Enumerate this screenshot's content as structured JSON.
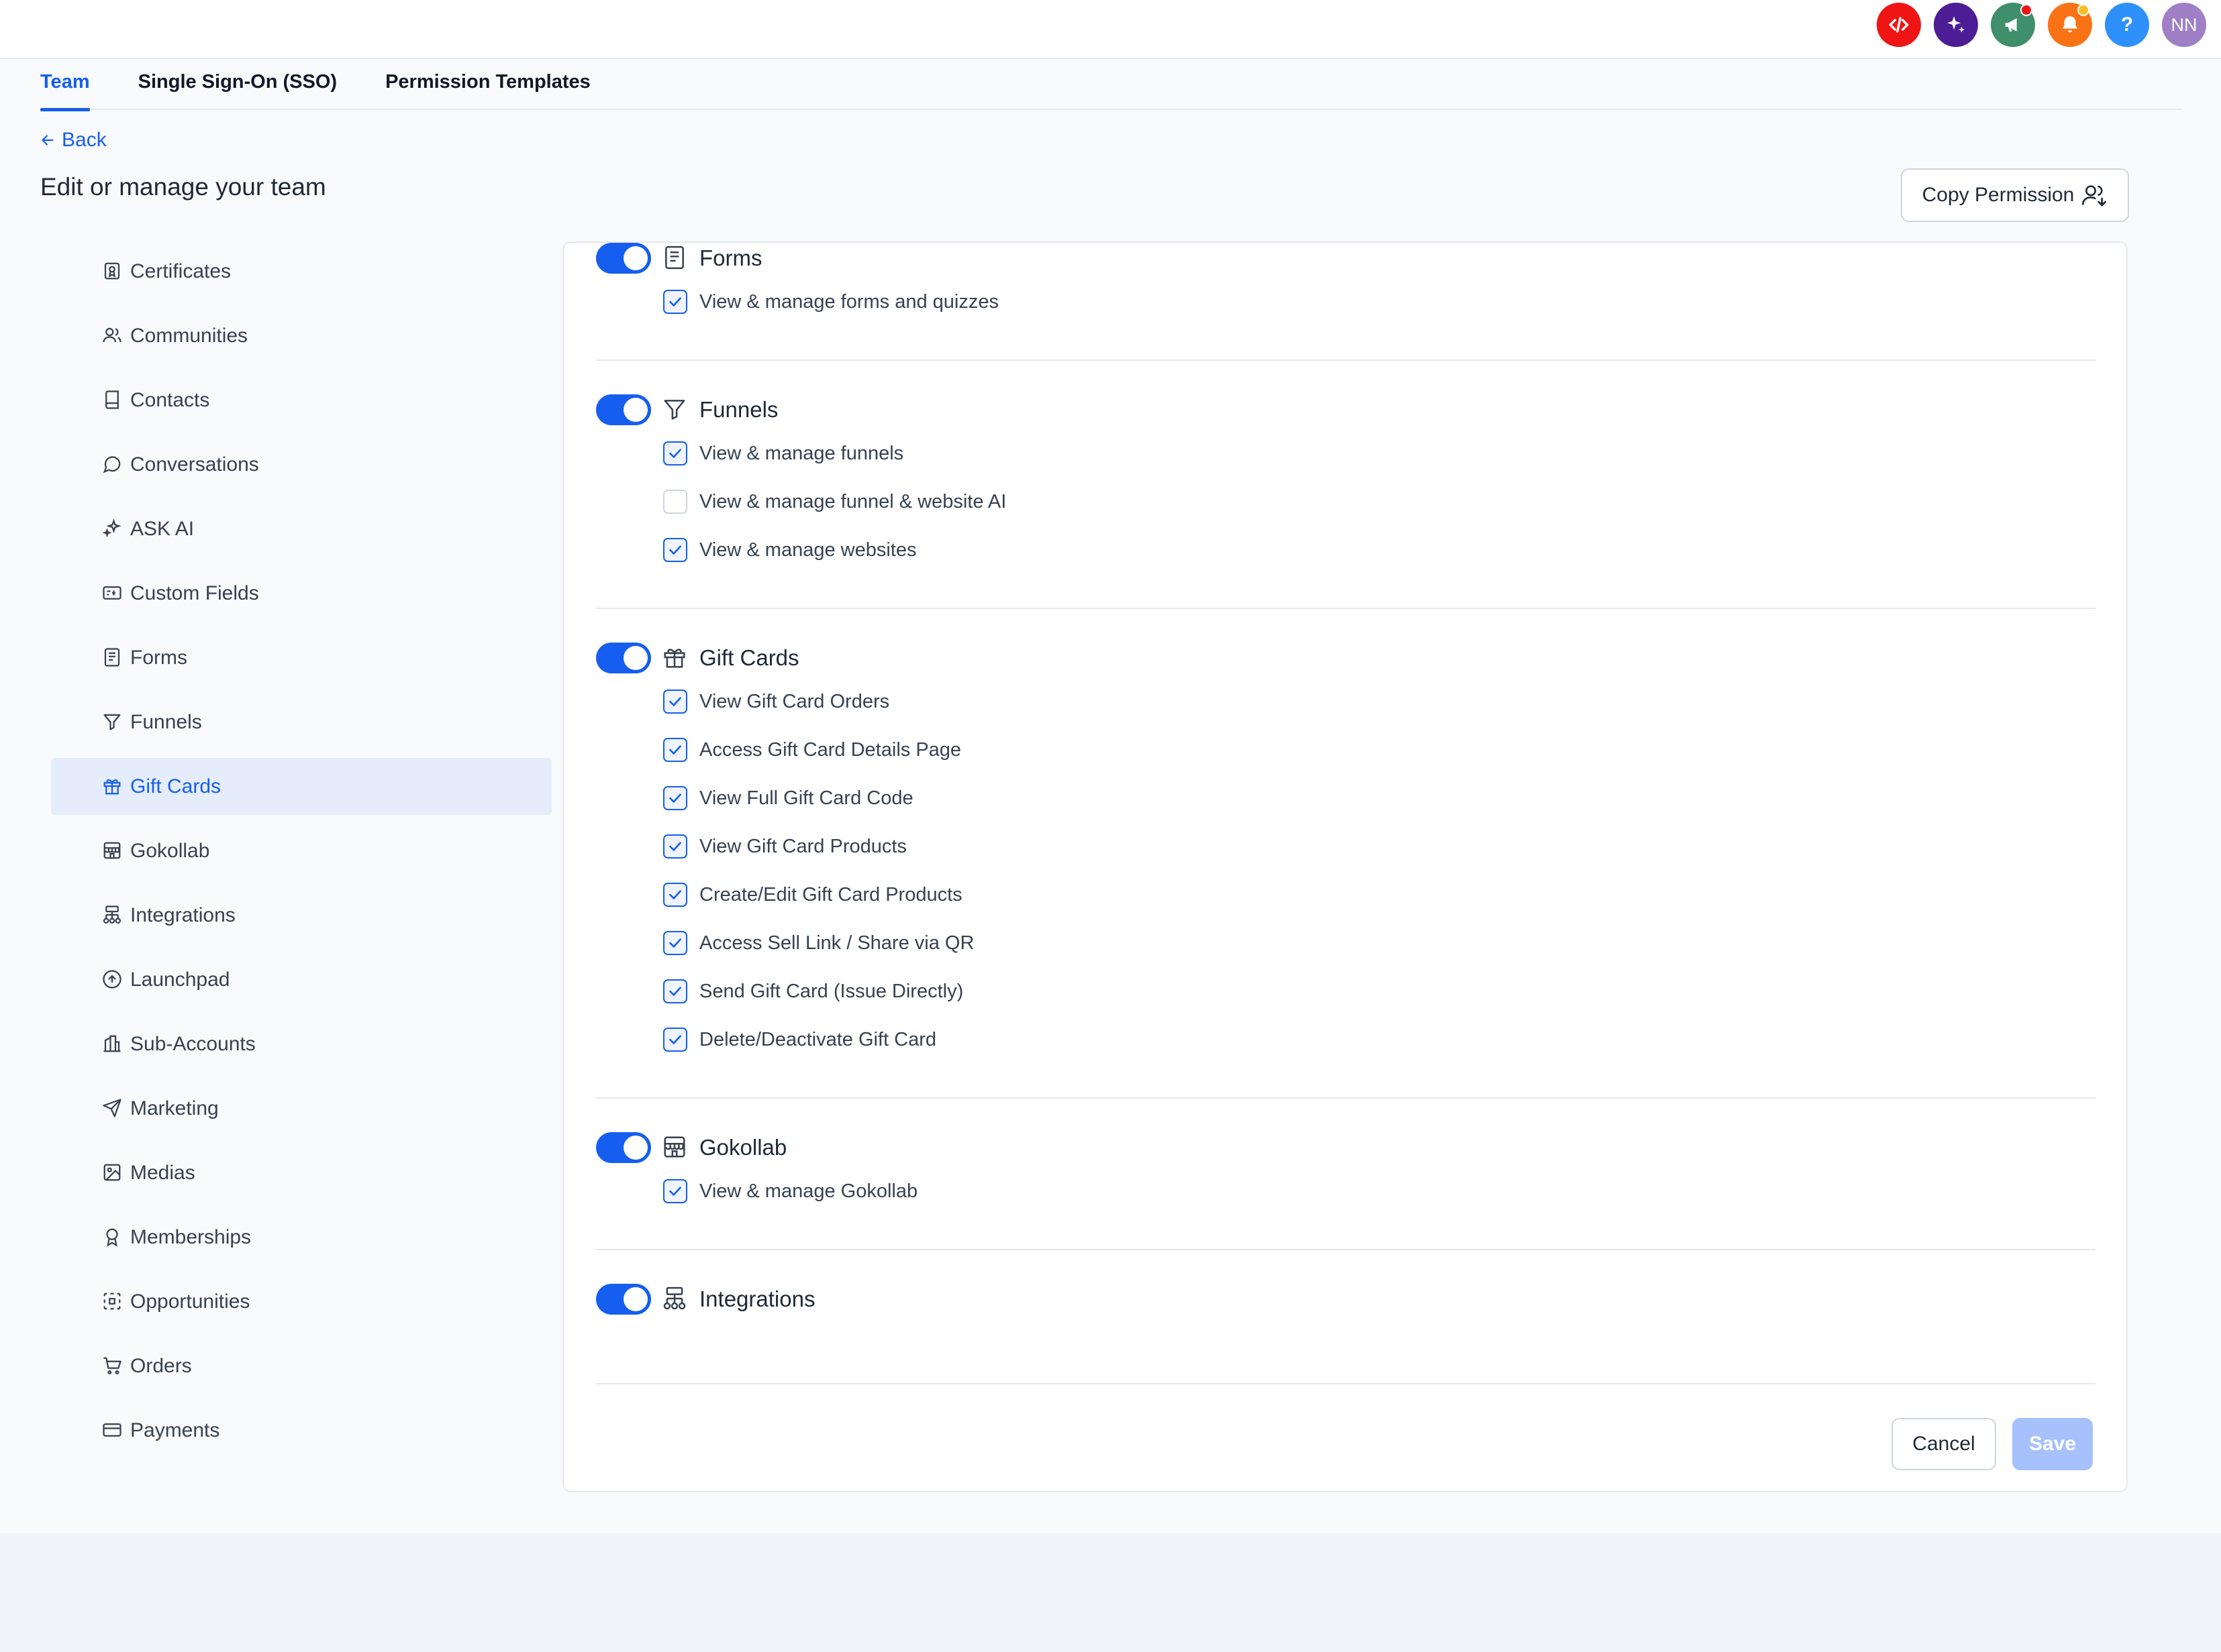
{
  "topbar": {
    "icons": [
      {
        "name": "code-icon",
        "color": "#ef1515"
      },
      {
        "name": "sparkle-icon",
        "color": "#4c1d95"
      },
      {
        "name": "megaphone-icon",
        "color": "#3f8f6a"
      },
      {
        "name": "bell-icon",
        "color": "#f97316"
      },
      {
        "name": "help-icon",
        "color": "#2e90fa"
      },
      {
        "name": "avatar",
        "color": "#9f7fc5"
      }
    ],
    "help_label": "?",
    "avatar_initials": "NN"
  },
  "tabs": [
    {
      "label": "Team",
      "active": true
    },
    {
      "label": "Single Sign-On (SSO)",
      "active": false
    },
    {
      "label": "Permission Templates",
      "active": false
    }
  ],
  "back_label": "Back",
  "page_title": "Edit or manage your team",
  "copy_permission_label": "Copy Permission",
  "sidebar": {
    "items": [
      {
        "label": "Certificates",
        "icon": "certificate-icon"
      },
      {
        "label": "Communities",
        "icon": "users-icon"
      },
      {
        "label": "Contacts",
        "icon": "book-icon"
      },
      {
        "label": "Conversations",
        "icon": "chat-icon"
      },
      {
        "label": "ASK AI",
        "icon": "sparkle-icon"
      },
      {
        "label": "Custom Fields",
        "icon": "custom-fields-icon"
      },
      {
        "label": "Forms",
        "icon": "form-icon"
      },
      {
        "label": "Funnels",
        "icon": "funnel-icon"
      },
      {
        "label": "Gift Cards",
        "icon": "gift-icon",
        "active": true
      },
      {
        "label": "Gokollab",
        "icon": "store-icon"
      },
      {
        "label": "Integrations",
        "icon": "integrations-icon"
      },
      {
        "label": "Launchpad",
        "icon": "launchpad-icon"
      },
      {
        "label": "Sub-Accounts",
        "icon": "building-icon"
      },
      {
        "label": "Marketing",
        "icon": "send-icon"
      },
      {
        "label": "Medias",
        "icon": "image-icon"
      },
      {
        "label": "Memberships",
        "icon": "award-icon"
      },
      {
        "label": "Opportunities",
        "icon": "opportunities-icon"
      },
      {
        "label": "Orders",
        "icon": "cart-icon"
      },
      {
        "label": "Payments",
        "icon": "payments-icon"
      }
    ]
  },
  "groups": [
    {
      "title": "Forms",
      "icon": "form-icon",
      "enabled": true,
      "permissions": [
        {
          "label": "View & manage forms and quizzes",
          "checked": true
        }
      ]
    },
    {
      "title": "Funnels",
      "icon": "funnel-icon",
      "enabled": true,
      "permissions": [
        {
          "label": "View & manage funnels",
          "checked": true
        },
        {
          "label": "View & manage funnel & website AI",
          "checked": false
        },
        {
          "label": "View & manage websites",
          "checked": true
        }
      ]
    },
    {
      "title": "Gift Cards",
      "icon": "gift-icon",
      "enabled": true,
      "permissions": [
        {
          "label": "View Gift Card Orders",
          "checked": true
        },
        {
          "label": "Access Gift Card Details Page",
          "checked": true
        },
        {
          "label": "View Full Gift Card Code",
          "checked": true
        },
        {
          "label": "View Gift Card Products",
          "checked": true
        },
        {
          "label": "Create/Edit Gift Card Products",
          "checked": true
        },
        {
          "label": "Access Sell Link / Share via QR",
          "checked": true
        },
        {
          "label": "Send Gift Card (Issue Directly)",
          "checked": true
        },
        {
          "label": "Delete/Deactivate Gift Card",
          "checked": true
        }
      ]
    },
    {
      "title": "Gokollab",
      "icon": "store-icon",
      "enabled": true,
      "permissions": [
        {
          "label": "View & manage Gokollab",
          "checked": true
        }
      ]
    },
    {
      "title": "Integrations",
      "icon": "integrations-icon",
      "enabled": true,
      "permissions": []
    }
  ],
  "actions": {
    "cancel_label": "Cancel",
    "save_label": "Save"
  },
  "colors": {
    "accent": "#155eef",
    "save_disabled": "#a6c1fb"
  }
}
